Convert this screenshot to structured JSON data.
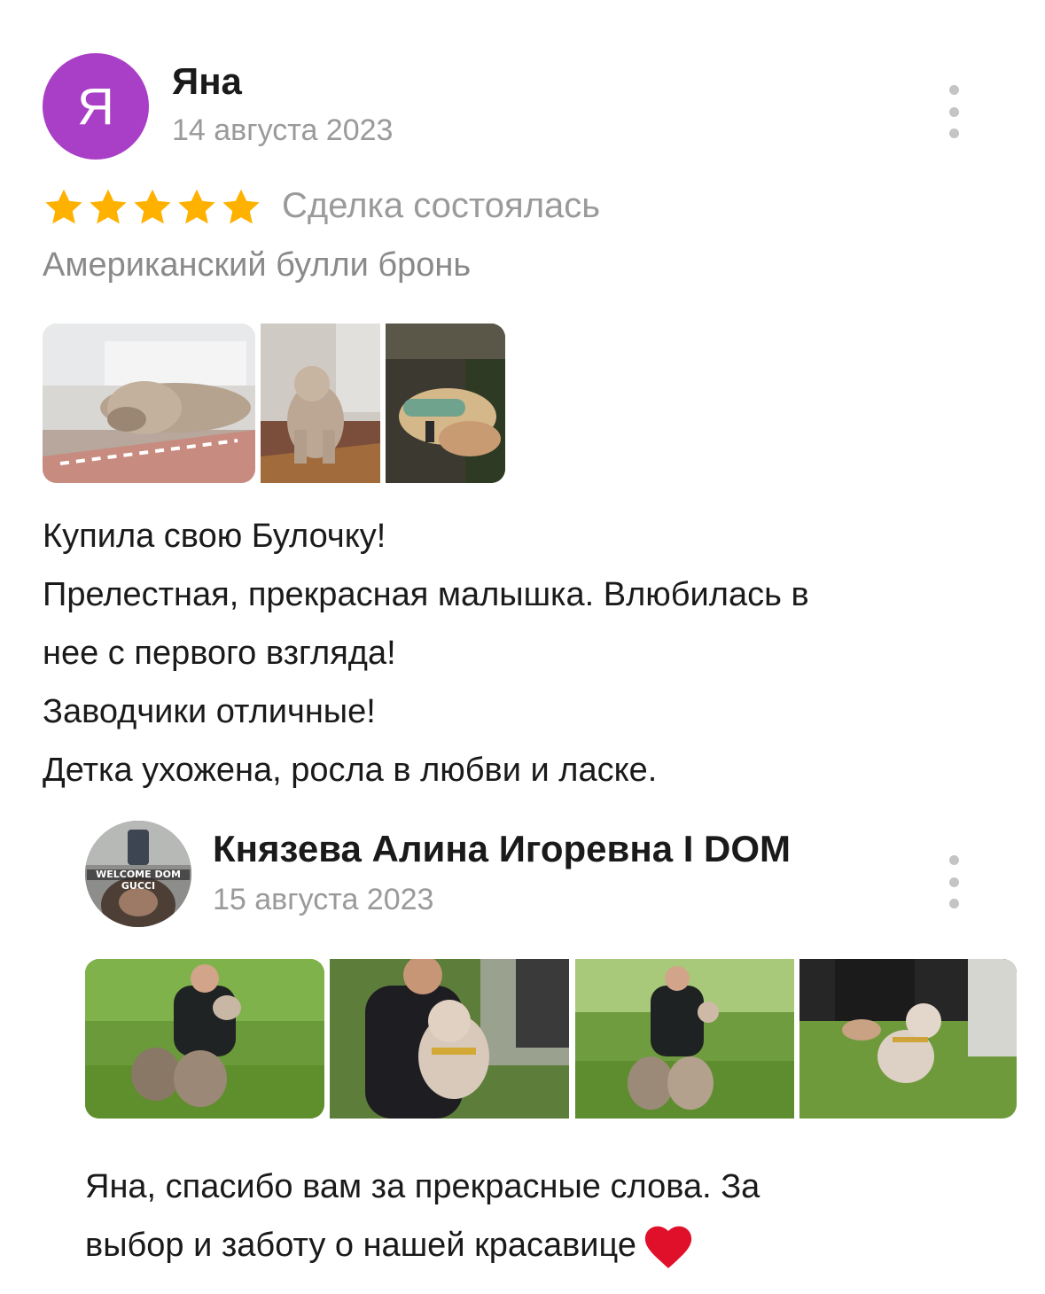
{
  "review": {
    "avatar_letter": "Я",
    "avatar_color": "#a93fc6",
    "author": "Яна",
    "date": "14 августа 2023",
    "rating": 5,
    "status": "Сделка состоялась",
    "product": "Американский булли бронь",
    "photos": [
      "dog-lying-on-rug-photo",
      "dog-sitting-photo",
      "dog-in-car-photo"
    ],
    "text_lines": [
      "Купила свою Булочку!",
      "Прелестная, прекрасная малышка. Влюбилась в",
      "нее с первого взгляда!",
      "Заводчики отличные!",
      "Детка ухожена, росла в любви и ласке."
    ],
    "menu_icon": "more-vertical-icon"
  },
  "reply": {
    "author": "Князева Алина Игоревна I DOM",
    "avatar_logo_text": "WELCOME DOM GUCCI",
    "date": "15 августа 2023",
    "photos": [
      "man-with-two-dogs-photo",
      "man-holding-puppy-photo",
      "man-with-dogs-garden-photo",
      "puppy-on-grass-photo"
    ],
    "text_lines": [
      "Яна, спасибо вам за прекрасные слова. За",
      "выбор и заботу о нашей красавице"
    ],
    "emoji": "heart-icon",
    "menu_icon": "more-vertical-icon"
  },
  "colors": {
    "star": "#ffb100",
    "muted": "#9a9a9a",
    "heart": "#e0102a"
  }
}
